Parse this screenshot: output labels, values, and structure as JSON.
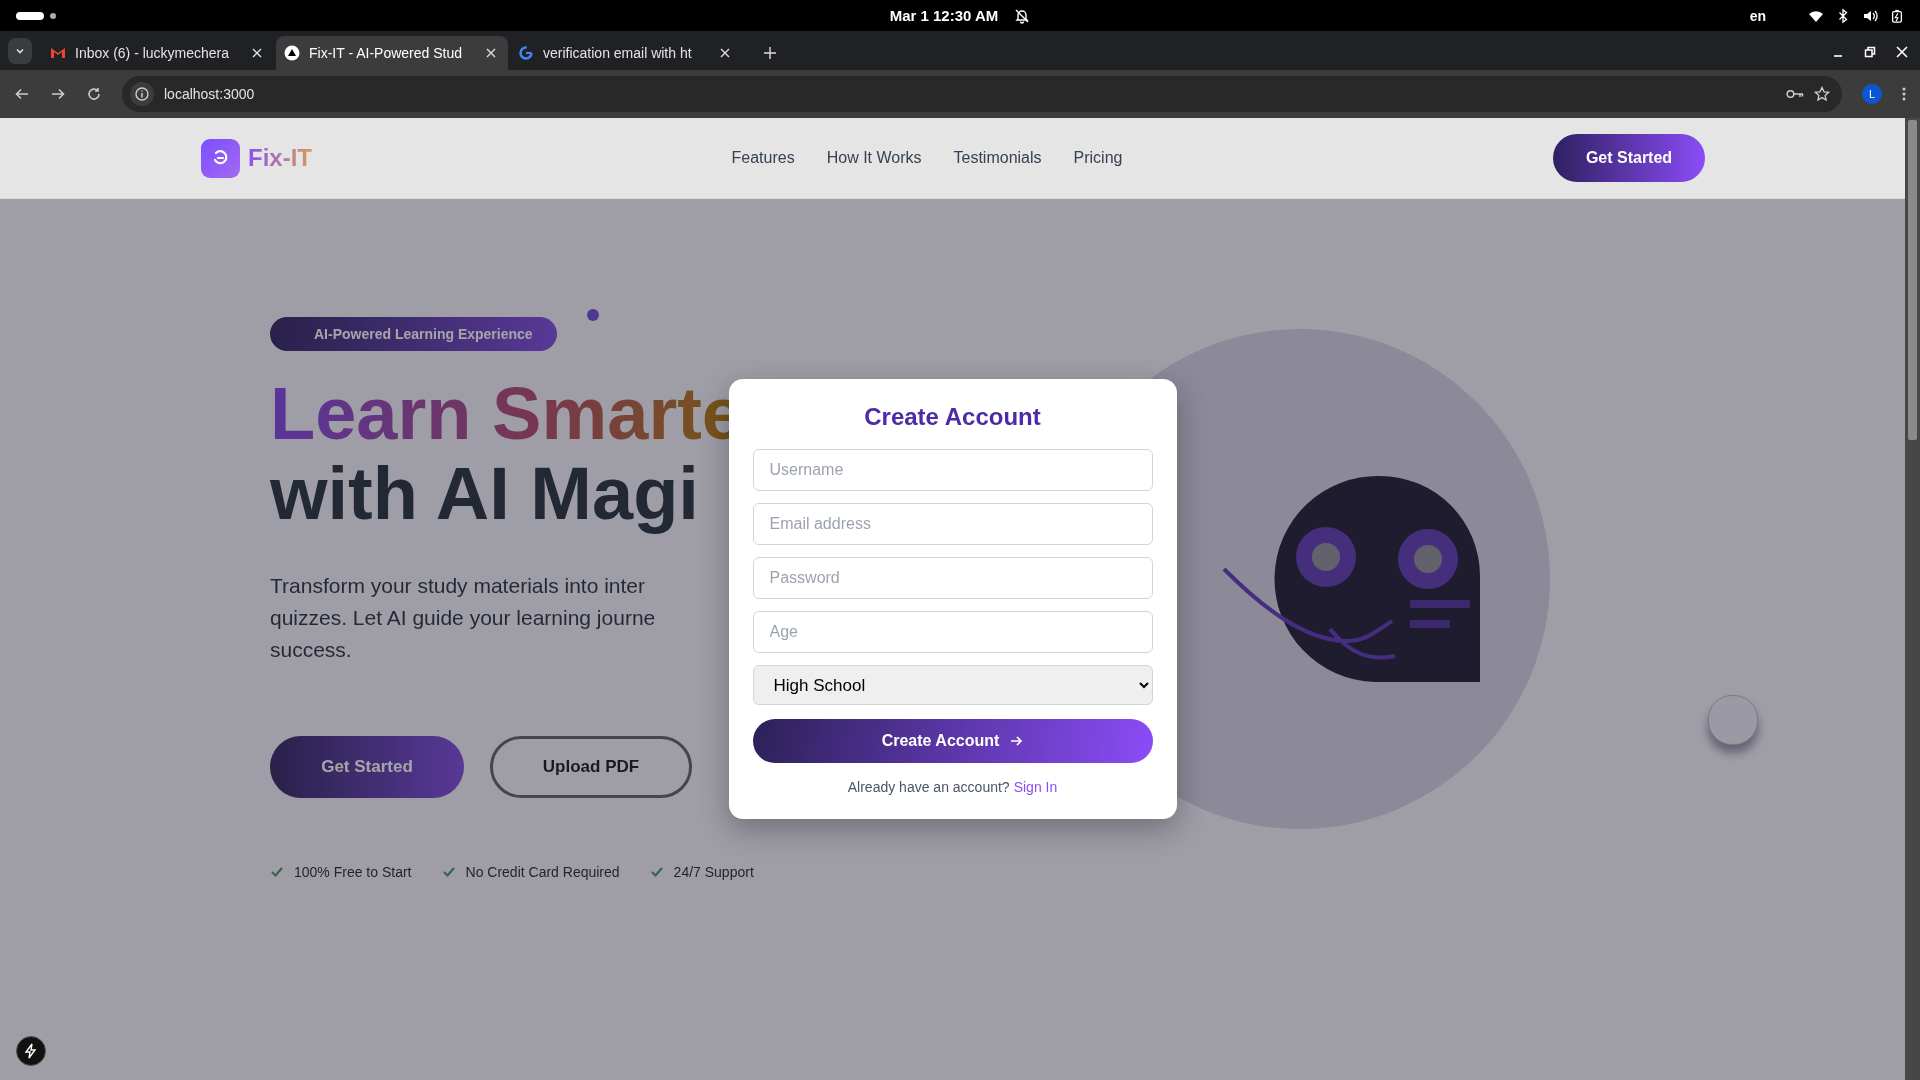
{
  "system_bar": {
    "date_time": "Mar 1  12:30 AM",
    "language": "en"
  },
  "browser": {
    "tabs": [
      {
        "title": "Inbox (6) - luckymechera",
        "selected": false,
        "kind": "mail"
      },
      {
        "title": "Fix-IT - AI-Powered Stud",
        "selected": true,
        "kind": "triangle"
      },
      {
        "title": "verification email with ht",
        "selected": false,
        "kind": "search"
      }
    ],
    "url": "localhost:3000",
    "profile_initial": "L"
  },
  "nav": {
    "brand": "Fix-IT",
    "links": [
      "Features",
      "How It Works",
      "Testimonials",
      "Pricing"
    ],
    "cta": "Get Started"
  },
  "hero": {
    "badge": "AI-Powered Learning Experience",
    "title_line_1": "Learn Smarte",
    "title_line_2": "with AI Magi",
    "description_lines": [
      "Transform your study materials into inter",
      "quizzes. Let AI guide your learning journe",
      "success."
    ],
    "primary_button": "Get Started",
    "secondary_button": "Upload PDF",
    "perks": [
      "100% Free to Start",
      "No Credit Card Required",
      "24/7 Support"
    ]
  },
  "modal": {
    "title": "Create Account",
    "fields": [
      {
        "placeholder": "Username"
      },
      {
        "placeholder": "Email address"
      },
      {
        "placeholder": "Password"
      },
      {
        "placeholder": "Age"
      }
    ],
    "level_select": {
      "value": "High School"
    },
    "submit": "Create Account",
    "footer_text": "Already have an account?",
    "footer_link": "Sign In"
  }
}
